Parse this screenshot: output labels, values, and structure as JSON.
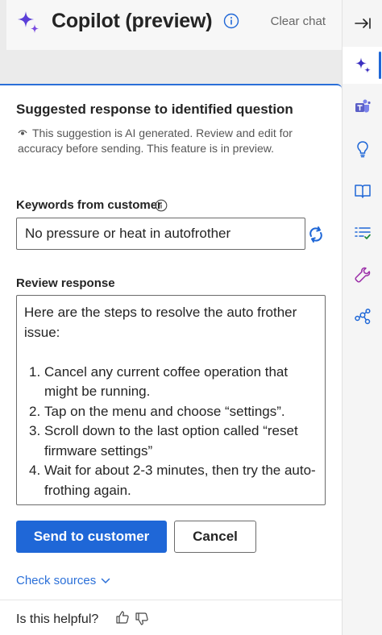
{
  "header": {
    "title": "Copilot (preview)",
    "clear_chat": "Clear chat"
  },
  "card": {
    "title": "Suggested response to identified question",
    "ai_note": "This suggestion is AI generated. Review and edit for accuracy before sending. This feature is in preview."
  },
  "keywords": {
    "label": "Keywords from customer",
    "value": "No pressure or heat in autofrother"
  },
  "review": {
    "label": "Review response",
    "intro": "Here are the steps to resolve the auto frother issue:",
    "steps": [
      {
        "num": "1.",
        "text": "Cancel any current coffee operation that might be running."
      },
      {
        "num": "2.",
        "text": "Tap on the menu and choose “settings”."
      },
      {
        "num": "3.",
        "text": "Scroll down to the last option called “reset firmware settings”"
      },
      {
        "num": "4.",
        "text": "Wait for about 2-3 minutes, then try the auto-frothing again."
      }
    ]
  },
  "actions": {
    "send": "Send to customer",
    "cancel": "Cancel"
  },
  "check_sources": "Check sources",
  "feedback": {
    "label": "Is this helpful?"
  },
  "colors": {
    "accent": "#1f67d7",
    "copilot_purple": "#5b3fd8"
  },
  "rail_icons": [
    "collapse-panel-icon",
    "copilot-sparkle-icon",
    "teams-icon",
    "lightbulb-icon",
    "knowledge-book-icon",
    "checklist-icon",
    "wrench-icon",
    "connections-icon"
  ]
}
